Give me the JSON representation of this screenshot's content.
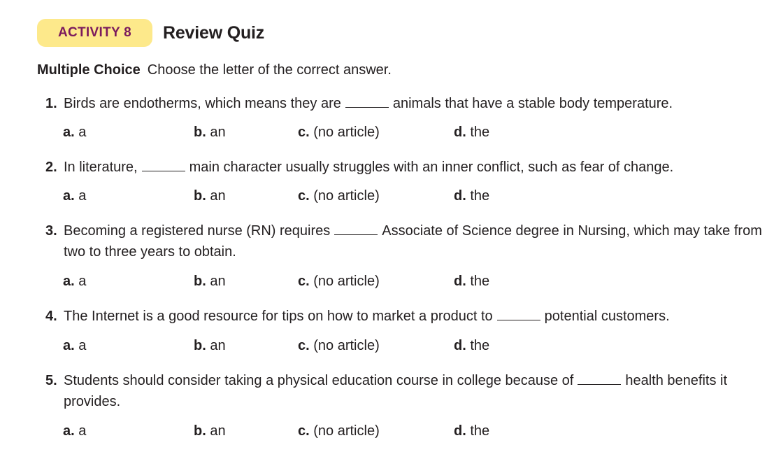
{
  "activity": {
    "badge": "ACTIVITY 8",
    "title": "Review Quiz"
  },
  "instructions": {
    "label": "Multiple Choice",
    "text": "Choose the letter of the correct answer."
  },
  "options": [
    {
      "letter": "a.",
      "text": "a"
    },
    {
      "letter": "b.",
      "text": "an"
    },
    {
      "letter": "c.",
      "text": "(no article)"
    },
    {
      "letter": "d.",
      "text": "the"
    }
  ],
  "questions": [
    {
      "number": "1.",
      "before": "Birds are endotherms, which means they are",
      "after": "animals that have a stable body temperature."
    },
    {
      "number": "2.",
      "before": "In literature,",
      "after": "main character usually struggles with an inner conflict, such as fear of change."
    },
    {
      "number": "3.",
      "before": "Becoming a registered nurse (RN) requires",
      "after": "Associate of Science degree in Nursing, which may take from two to three years to obtain."
    },
    {
      "number": "4.",
      "before": "The Internet is a good resource for tips on how to market a product to",
      "after": "potential customers."
    },
    {
      "number": "5.",
      "before": "Students should consider taking a physical education course in college because of",
      "after": "health benefits it provides."
    }
  ]
}
